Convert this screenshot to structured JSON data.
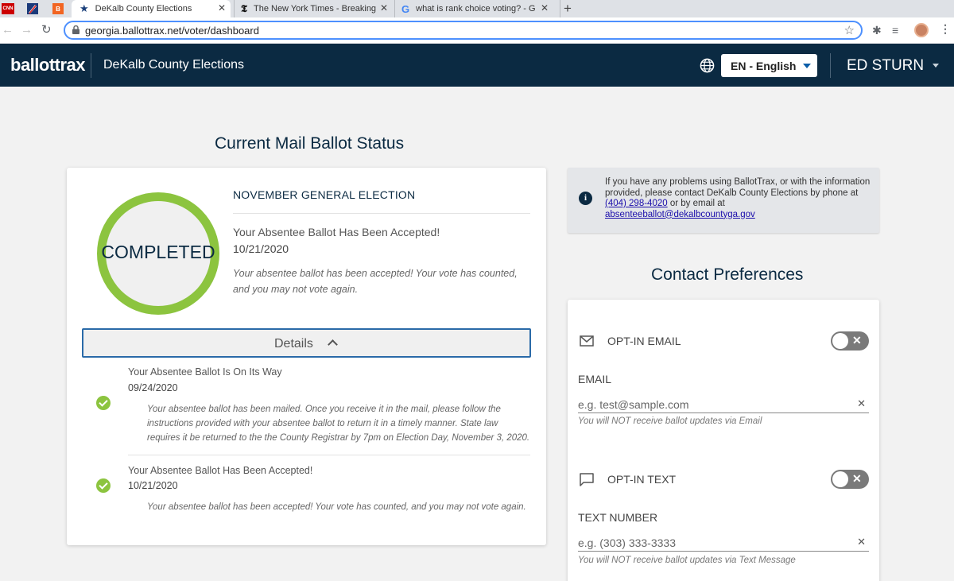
{
  "browser": {
    "tabs": [
      {
        "title": "",
        "favicon": "cnn-logo",
        "color": "#cc0000",
        "glyph": "CNN"
      },
      {
        "title": "",
        "favicon": "flag-logo",
        "color": "#1b3a7a",
        "glyph": ""
      },
      {
        "title": "",
        "favicon": "b-logo",
        "color": "#f26522",
        "glyph": "B"
      },
      {
        "title": "DeKalb County Elections",
        "favicon": "star-icon",
        "active": true
      },
      {
        "title": "The New York Times - Breaking",
        "favicon": "nyt-logo"
      },
      {
        "title": "what is rank choice voting? - G",
        "favicon": "google-logo"
      }
    ],
    "tab_close": "✕",
    "new_tab": "+",
    "url": "georgia.ballottrax.net/voter/dashboard"
  },
  "header": {
    "logo": "ballottrax",
    "county": "DeKalb County Elections",
    "language": "EN - English",
    "user": "ED STURN"
  },
  "ballot_status": {
    "heading": "Current Mail Ballot Status",
    "election": "NOVEMBER GENERAL ELECTION",
    "ring_label": "COMPLETED",
    "ring_color": "#8cc43f",
    "status_title": "Your Absentee Ballot Has Been Accepted!",
    "status_date": "10/21/2020",
    "status_desc": "Your absentee ballot has been accepted! Your vote has counted, and you may not vote again.",
    "details_label": "Details",
    "timeline": [
      {
        "title": "Your Absentee Ballot Is On Its Way",
        "date": "09/24/2020",
        "desc": "Your absentee ballot has been mailed. Once you receive it in the mail, please follow the instructions provided with your absentee ballot to return it in a timely manner. State law requires it be returned to the the County Registrar by 7pm on Election Day, November 3, 2020."
      },
      {
        "title": "Your Absentee Ballot Has Been Accepted!",
        "date": "10/21/2020",
        "desc": "Your absentee ballot has been accepted! Your vote has counted, and you may not vote again."
      }
    ]
  },
  "info_box": {
    "text_before": "If you have any problems using BallotTrax, or with the information provided, please contact DeKalb County Elections by phone at ",
    "phone": "(404) 298-4020",
    "text_middle": " or by email at ",
    "email": "absenteeballot@dekalbcountyga.gov"
  },
  "contact": {
    "heading": "Contact Preferences",
    "email_optin": "OPT-IN EMAIL",
    "email_label": "EMAIL",
    "email_placeholder": "e.g. test@sample.com",
    "email_hint": "You will NOT receive ballot updates via Email",
    "text_optin": "OPT-IN TEXT",
    "text_label": "TEXT NUMBER",
    "text_placeholder": "e.g. (303) 333-3333",
    "text_hint": "You will NOT receive ballot updates via Text Message"
  },
  "colors": {
    "navy": "#0b2a42",
    "green": "#8cc43f",
    "blue_border": "#2a6aa8"
  }
}
